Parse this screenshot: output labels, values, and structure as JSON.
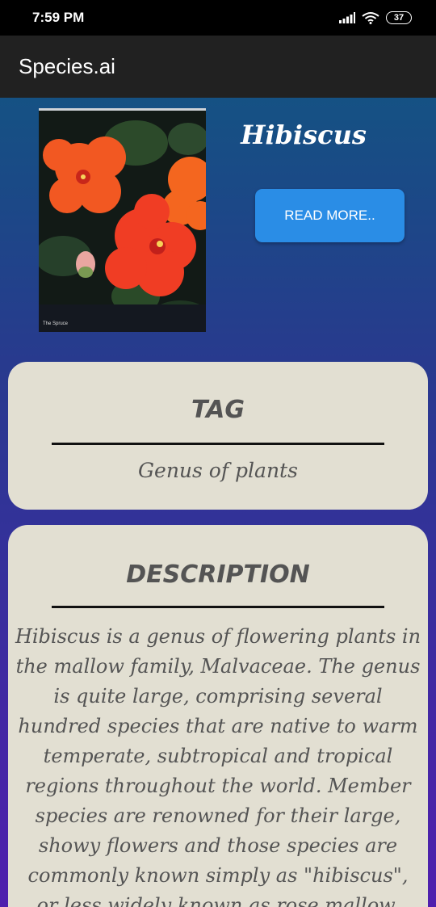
{
  "status_bar": {
    "time": "7:59 PM",
    "battery": "37",
    "icons": [
      "signal-icon",
      "wifi-icon",
      "battery-icon"
    ]
  },
  "app_bar": {
    "title": "Species.ai"
  },
  "species": {
    "name": "Hibiscus",
    "image_credit": "The Spruce",
    "read_more_label": "READ MORE.."
  },
  "tag_card": {
    "heading": "TAG",
    "value": "Genus of plants"
  },
  "description_card": {
    "heading": "DESCRIPTION",
    "text": "Hibiscus is a genus of flowering plants in the mallow family, Malvaceae. The genus is quite large, comprising several hundred species that are native to warm temperate, subtropical and tropical regions throughout the world. Member species are renowned for their large, showy flowers and those species are commonly known simply as \"hibiscus\", or less widely known as rose mallow. Other"
  },
  "colors": {
    "status_bar_bg": "#000000",
    "app_bar_bg": "#212121",
    "button_accent": "#2a8de6",
    "card_bg": "#e2dfd2",
    "card_text": "#545454"
  }
}
